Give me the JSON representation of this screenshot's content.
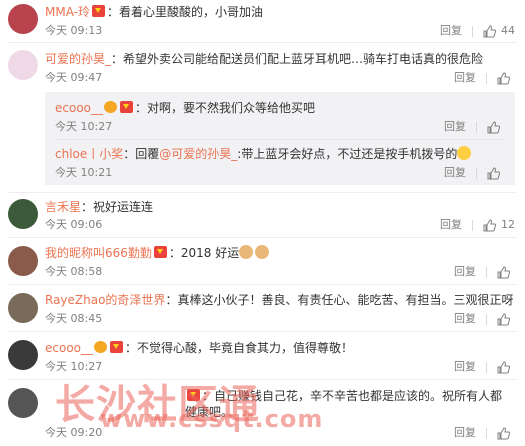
{
  "actions": {
    "reply": "回复"
  },
  "comments": [
    {
      "user": "MMA-玲",
      "text": "：看着心里酸酸的，小哥加油",
      "time": "今天 09:13",
      "likes": "44",
      "avatar_color": "#b8434d"
    },
    {
      "user": "可爱的孙昊_",
      "text": "：希望外卖公司能给配送员们配上蓝牙耳机吧…骑车打电话真的很危险",
      "time": "今天 09:47",
      "likes": "",
      "avatar_color": "#f0d9e6",
      "replies": [
        {
          "user": "ecooo__",
          "text": "：对啊，要不然我们众等给他买吧",
          "time": "今天 10:27",
          "likes": ""
        },
        {
          "user": "chloe丨小奖",
          "text_prefix": "：回覆",
          "mention": "@可爱的孙昊_",
          "text": ":带上蓝牙会好点，不过还是按手机拨号的",
          "time": "今天 10:21",
          "likes": ""
        }
      ]
    },
    {
      "user": "言禾星",
      "text": "：祝好运连连",
      "time": "今天 09:06",
      "likes": "12",
      "avatar_color": "#3c5a3a"
    },
    {
      "user": "我的昵称叫666勤勤",
      "text": "：2018 好运",
      "time": "今天 08:58",
      "likes": "",
      "avatar_color": "#8a5a4a"
    },
    {
      "user": "RayeZhao的奇泽世界",
      "text": "：真棒这小伙子！善良、有责任心、能吃苦、有担当。三观很正呀",
      "time": "今天 08:45",
      "likes": "",
      "avatar_color": "#7a6a5a"
    },
    {
      "user": "ecooo__",
      "text": "：不觉得心酸，毕竟自食其力，值得尊敬！",
      "time": "今天 10:27",
      "likes": "",
      "avatar_color": "#3a3a3a"
    },
    {
      "user": "",
      "text": "：自己赚钱自己花，辛不辛苦也都是应该的。祝所有人都健康吧。",
      "time": "今天 09:20",
      "likes": "",
      "avatar_color": "#555555"
    }
  ],
  "watermark": {
    "line1": "长沙社区通",
    "line2": "www.cssqt.com"
  }
}
